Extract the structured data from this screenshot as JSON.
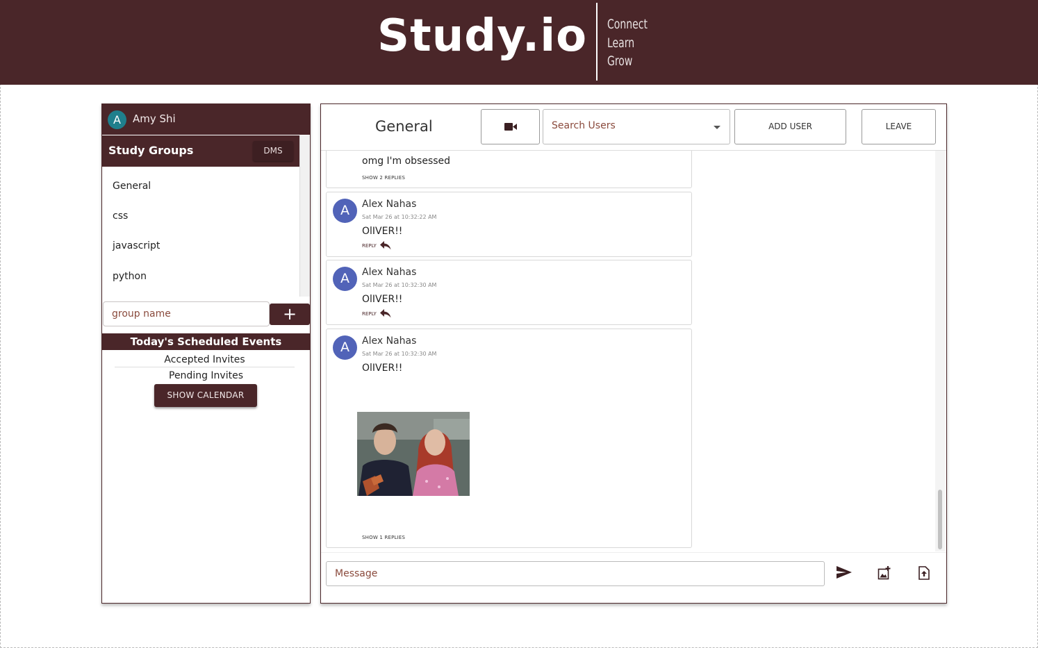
{
  "header": {
    "logo": "Study.io",
    "tagline": [
      "Connect",
      "Learn",
      "Grow"
    ]
  },
  "sidebar": {
    "user": {
      "initial": "A",
      "name": "Amy Shi"
    },
    "groups_title": "Study Groups",
    "dms_label": "DMS",
    "groups": [
      "General",
      "css",
      "javascript",
      "python"
    ],
    "group_input_placeholder": "group name",
    "add_group_label": "+",
    "events_title": "Today's Scheduled Events",
    "accepted_label": "Accepted Invites",
    "pending_label": "Pending Invites",
    "calendar_label": "SHOW CALENDAR"
  },
  "chat": {
    "channel": "General",
    "search_placeholder": "Search Users",
    "add_user_label": "ADD USER",
    "leave_label": "LEAVE",
    "message_placeholder": "Message",
    "messages": [
      {
        "text": "omg I'm obsessed",
        "show_replies": "SHOW 2 REPLIES"
      },
      {
        "initial": "A",
        "author": "Alex Nahas",
        "time": "Sat Mar 26 at 10:32:22 AM",
        "text": "OlIVER!!",
        "reply": "REPLY"
      },
      {
        "initial": "A",
        "author": "Alex Nahas",
        "time": "Sat Mar 26 at 10:32:30 AM",
        "text": "OlIVER!!",
        "reply": "REPLY"
      },
      {
        "initial": "A",
        "author": "Alex Nahas",
        "time": "Sat Mar 26 at 10:32:30 AM",
        "text": "OlIVER!!",
        "show_replies": "SHOW 1 REPLIES"
      }
    ]
  },
  "colors": {
    "brand": "#4a2629",
    "avatar_user": "#1f7f8c",
    "avatar_message": "#5163b8"
  },
  "icons": [
    "video-camera-icon",
    "dropdown-caret-icon",
    "reply-arrow-icon",
    "send-icon",
    "add-image-icon",
    "upload-file-icon"
  ]
}
